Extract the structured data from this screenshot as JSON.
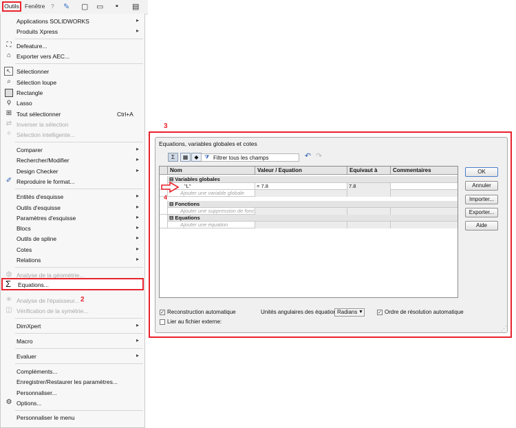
{
  "topbar": {
    "outils": "Outils",
    "fenetre": "Fenêtre",
    "help": "?",
    "pin_icon": "pin-icon",
    "new_icon": "new-document-icon",
    "open_icon": "open-folder-icon",
    "save_icon": "save-icon",
    "print_icon": "print-icon"
  },
  "annotations": {
    "n1": "1",
    "n2": "2",
    "n3": "3",
    "n4": "4",
    "accent": "#e8212b"
  },
  "menu": {
    "items": [
      {
        "label": "Applications SOLIDWORKS",
        "arrow": "▸"
      },
      {
        "label": "Produits Xpress",
        "arrow": "▸"
      },
      {
        "label": "Defeature...",
        "icon": "defeature-icon"
      },
      {
        "label": "Exporter vers AEC...",
        "icon": "export-aec-icon"
      },
      {
        "label": "Sélectionner",
        "icon": "select-cursor-icon"
      },
      {
        "label": "Sélection loupe",
        "icon": "magnifier-icon"
      },
      {
        "label": "Rectangle",
        "icon": "rectangle-icon"
      },
      {
        "label": "Lasso",
        "icon": "lasso-icon"
      },
      {
        "label": "Tout sélectionner",
        "shortcut": "Ctrl+A",
        "icon": "select-all-icon"
      },
      {
        "label": "Inverser la sélection",
        "icon": "invert-selection-icon"
      },
      {
        "label": "Sélection intelligente...",
        "icon": "smart-selection-icon"
      },
      {
        "label": "Comparer",
        "arrow": "▸"
      },
      {
        "label": "Rechercher/Modifier",
        "arrow": "▸"
      },
      {
        "label": "Design Checker",
        "arrow": "▸"
      },
      {
        "label": "Reproduire le format...",
        "icon": "format-painter-icon"
      },
      {
        "label": "Entités d'esquisse",
        "arrow": "▸"
      },
      {
        "label": "Outils d'esquisse",
        "arrow": "▸"
      },
      {
        "label": "Paramètres d'esquisse",
        "arrow": "▸"
      },
      {
        "label": "Blocs",
        "arrow": "▸"
      },
      {
        "label": "Outils de spline",
        "arrow": "▸"
      },
      {
        "label": "Cotes",
        "arrow": "▸"
      },
      {
        "label": "Relations",
        "arrow": "▸"
      },
      {
        "label": "Analyse de la géométrie...",
        "icon": "geometry-analysis-icon"
      },
      {
        "label": "Equations...",
        "icon": "sigma-icon"
      },
      {
        "label": "Analyse de l'épaisseur...",
        "icon": "thickness-analysis-icon"
      },
      {
        "label": "Vérification de la symétrie...",
        "icon": "symmetry-check-icon"
      },
      {
        "label": "DimXpert",
        "arrow": "▸"
      },
      {
        "label": "Macro",
        "arrow": "▸"
      },
      {
        "label": "Evaluer",
        "arrow": "▸"
      },
      {
        "label": "Compléments..."
      },
      {
        "label": "Enregistrer/Restaurer les paramètres..."
      },
      {
        "label": "Personnaliser..."
      },
      {
        "label": "Options...",
        "icon": "gear-icon"
      },
      {
        "label": "Personnaliser le menu"
      }
    ]
  },
  "dialog": {
    "title": "Equations, variables globales et cotes",
    "filter_label": "Filtrer tous les champs",
    "toolbar_icons": [
      "sigma-view-icon",
      "sort-view-icon",
      "dimension-view-icon",
      "ordered-view-icon",
      "filter-icon",
      "undo-icon",
      "redo-icon"
    ],
    "columns": [
      "Nom",
      "Valeur / Equation",
      "Equivaut à",
      "Commentaires"
    ],
    "groups": {
      "variables": "Variables globales",
      "fonctions": "Fonctions",
      "equations": "Equations"
    },
    "rows": {
      "var1": {
        "name": "\"L\"",
        "value": "= 7.8",
        "evaluates": "7.8"
      },
      "add_var": "Ajouter une variable globale",
      "add_func": "Ajouter une suppression de fonction",
      "add_eq": "Ajouter une équation"
    },
    "buttons": {
      "ok": "OK",
      "cancel": "Annuler",
      "import": "Importer...",
      "export": "Exporter...",
      "help": "Aide"
    },
    "bottom": {
      "auto_rebuild": "Reconstruction automatique",
      "auto_rebuild_checked": true,
      "angular_units_label": "Unités angulaires des équation",
      "angular_units_value": "Radians",
      "solve_order": "Ordre de résolution automatique",
      "solve_order_checked": true,
      "link_file": "Lier au fichier externe:",
      "link_file_checked": false
    }
  }
}
